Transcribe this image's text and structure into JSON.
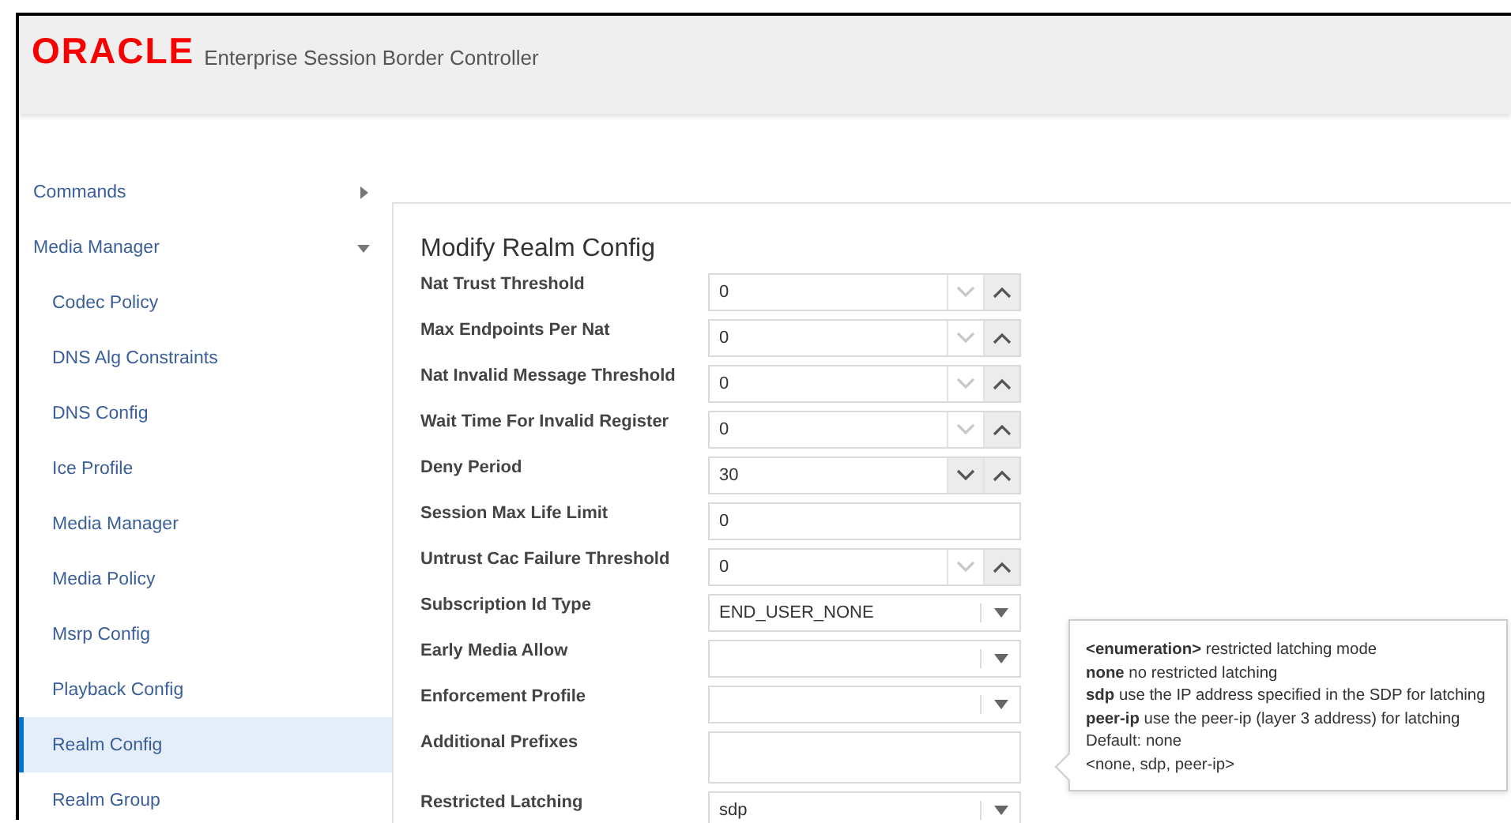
{
  "header": {
    "logo": "ORACLE",
    "title": "Enterprise Session Border Controller"
  },
  "sidebar": {
    "items": [
      {
        "label": "Commands",
        "expanded": false,
        "selected": false
      },
      {
        "label": "Media Manager",
        "expanded": true,
        "selected": false,
        "children": [
          {
            "label": "Codec Policy",
            "selected": false
          },
          {
            "label": "DNS Alg Constraints",
            "selected": false
          },
          {
            "label": "DNS Config",
            "selected": false
          },
          {
            "label": "Ice Profile",
            "selected": false
          },
          {
            "label": "Media Manager",
            "selected": false
          },
          {
            "label": "Media Policy",
            "selected": false
          },
          {
            "label": "Msrp Config",
            "selected": false
          },
          {
            "label": "Playback Config",
            "selected": false
          },
          {
            "label": "Realm Config",
            "selected": true
          },
          {
            "label": "Realm Group",
            "selected": false
          }
        ]
      }
    ]
  },
  "form": {
    "title": "Modify Realm Config",
    "fields": [
      {
        "label": "Nat Trust Threshold",
        "kind": "number",
        "value": "0",
        "down_disabled": true
      },
      {
        "label": "Max Endpoints Per Nat",
        "kind": "number",
        "value": "0",
        "down_disabled": true
      },
      {
        "label": "Nat Invalid Message Threshold",
        "kind": "number",
        "value": "0",
        "down_disabled": true
      },
      {
        "label": "Wait Time For Invalid Register",
        "kind": "number",
        "value": "0",
        "down_disabled": true
      },
      {
        "label": "Deny Period",
        "kind": "number",
        "value": "30",
        "down_disabled": false
      },
      {
        "label": "Session Max Life Limit",
        "kind": "text",
        "value": "0"
      },
      {
        "label": "Untrust Cac Failure Threshold",
        "kind": "number",
        "value": "0",
        "down_disabled": true
      },
      {
        "label": "Subscription Id Type",
        "kind": "select",
        "value": "END_USER_NONE"
      },
      {
        "label": "Early Media Allow",
        "kind": "select"
      },
      {
        "label": "Enforcement Profile",
        "kind": "select"
      },
      {
        "label": "Additional Prefixes",
        "kind": "textarea"
      },
      {
        "label": "Restricted Latching",
        "kind": "select",
        "value": "sdp"
      }
    ]
  },
  "tooltip": {
    "lines": [
      "**<enumeration>** restricted latching mode",
      "**none** no restricted latching",
      "**sdp** use the IP address specified in the SDP for latching",
      "**peer-ip** use the peer-ip (layer 3 address) for latching",
      "Default: none",
      "<none, sdp, peer-ip>"
    ]
  }
}
